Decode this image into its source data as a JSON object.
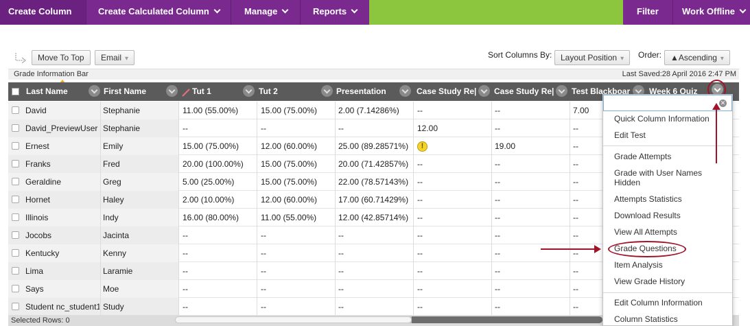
{
  "top_nav": {
    "create_column": "Create Column",
    "create_calculated_column": "Create Calculated Column",
    "manage": "Manage",
    "reports": "Reports",
    "filter": "Filter",
    "work_offline": "Work Offline"
  },
  "toolbar": {
    "move_to_top": "Move To Top",
    "email": "Email",
    "sort_columns_by_label": "Sort Columns By:",
    "sort_columns_by_value": "Layout Position",
    "order_label": "Order:",
    "order_value": "▲Ascending"
  },
  "info_bar": {
    "title": "Grade Information Bar",
    "last_saved": "Last Saved:28 April 2016 2:47 PM"
  },
  "table": {
    "headers": [
      "Last Name",
      "First Name",
      "Tut 1",
      "Tut 2",
      "Presentation",
      "Case Study Re|",
      "Case Study Re|",
      "Test Blackboar",
      "Week 6 Quiz"
    ],
    "rows": [
      {
        "last": "David",
        "first": "Stephanie",
        "c": [
          "11.00 (55.00%)",
          "15.00 (75.00%)",
          "2.00 (7.14286%)",
          "--",
          "--",
          "7.00"
        ]
      },
      {
        "last": "David_PreviewUser",
        "first": "Stephanie",
        "c": [
          "--",
          "--",
          "--",
          "12.00",
          "--",
          "--"
        ]
      },
      {
        "last": "Ernest",
        "first": "Emily",
        "c": [
          "15.00 (75.00%)",
          "12.00 (60.00%)",
          "25.00 (89.28571%)",
          "!",
          "19.00",
          "--"
        ]
      },
      {
        "last": "Franks",
        "first": "Fred",
        "c": [
          "20.00 (100.00%)",
          "15.00 (75.00%)",
          "20.00 (71.42857%)",
          "--",
          "--",
          "--"
        ]
      },
      {
        "last": "Geraldine",
        "first": "Greg",
        "c": [
          "5.00 (25.00%)",
          "15.00 (75.00%)",
          "22.00 (78.57143%)",
          "--",
          "--",
          "--"
        ]
      },
      {
        "last": "Hornet",
        "first": "Haley",
        "c": [
          "2.00 (10.00%)",
          "12.00 (60.00%)",
          "17.00 (60.71429%)",
          "--",
          "--",
          "--"
        ]
      },
      {
        "last": "Illinois",
        "first": "Indy",
        "c": [
          "16.00 (80.00%)",
          "11.00 (55.00%)",
          "12.00 (42.85714%)",
          "--",
          "--",
          "--"
        ]
      },
      {
        "last": "Jocobs",
        "first": "Jacinta",
        "c": [
          "--",
          "--",
          "--",
          "--",
          "--",
          "--"
        ]
      },
      {
        "last": "Kentucky",
        "first": "Kenny",
        "c": [
          "--",
          "--",
          "--",
          "--",
          "--",
          "--"
        ]
      },
      {
        "last": "Lima",
        "first": "Laramie",
        "c": [
          "--",
          "--",
          "--",
          "--",
          "--",
          "--"
        ]
      },
      {
        "last": "Says",
        "first": "Moe",
        "c": [
          "--",
          "--",
          "--",
          "--",
          "--",
          "--"
        ]
      },
      {
        "last": "Student nc_student1",
        "first": "Study",
        "c": [
          "--",
          "--",
          "--",
          "--",
          "--",
          "--"
        ]
      }
    ]
  },
  "footer": {
    "selected_rows": "Selected Rows: 0"
  },
  "context_menu": {
    "items": [
      "Quick Column Information",
      "Edit Test",
      "Grade Attempts",
      "Grade with User Names Hidden",
      "Attempts Statistics",
      "Download Results",
      "View All Attempts",
      "Grade Questions",
      "Item Analysis",
      "View Grade History",
      "Edit Column Information",
      "Column Statistics"
    ]
  },
  "colors": {
    "nav_purple": "#7a2a8e",
    "nav_green": "#8cc63e",
    "header_gray": "#5b5b5b",
    "annotation_red": "#a0142a"
  }
}
